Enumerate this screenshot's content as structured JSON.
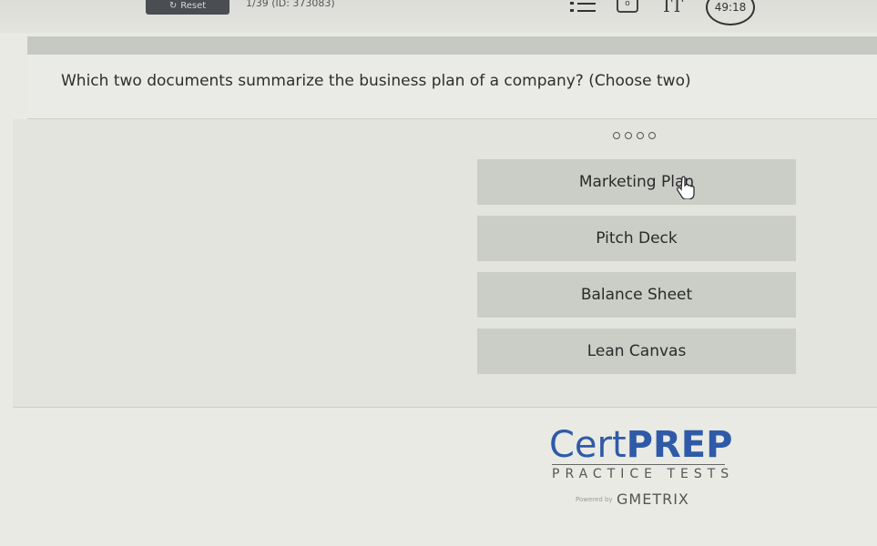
{
  "toolbar": {
    "reset_label": "Reset",
    "question_counter": "1/39 (ID: 373083)",
    "timer": "49:18"
  },
  "question": {
    "text": "Which two documents summarize the business plan of a company? (Choose two)"
  },
  "options": [
    {
      "label": "Marketing Plan"
    },
    {
      "label": "Pitch Deck"
    },
    {
      "label": "Balance Sheet"
    },
    {
      "label": "Lean Canvas"
    }
  ],
  "brand": {
    "name_light": "Cert",
    "name_bold": "PREP",
    "tagline": "PRACTICE TESTS",
    "powered_by": "Powered by",
    "partner": "GMETRIX"
  },
  "icons": [
    "reset-icon",
    "list-icon",
    "camera-icon",
    "text-size-icon",
    "hand-cursor-icon"
  ],
  "colors": {
    "brand_blue": "#2f5aa8",
    "option_bg": "#cbcdc7",
    "page_bg": "#e9eae4"
  }
}
